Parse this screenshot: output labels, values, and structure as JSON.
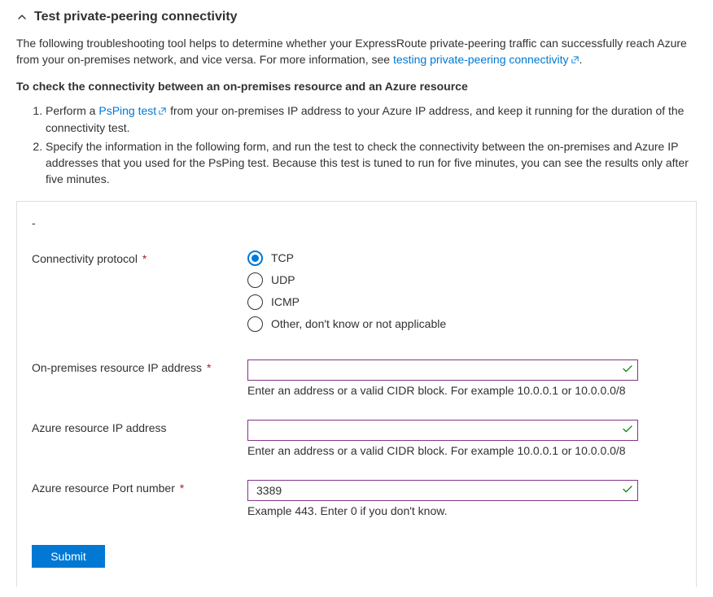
{
  "header": {
    "title": "Test private-peering connectivity"
  },
  "intro": {
    "text_before_link": "The following troubleshooting tool helps to determine whether your ExpressRoute private-peering traffic can successfully reach Azure from your on-premises network, and vice versa. For more information, see ",
    "link_text": "testing private-peering connectivity",
    "text_after_link": "."
  },
  "subheading": "To check the connectivity between an on-premises resource and an Azure resource",
  "steps": {
    "item1_before": "Perform a ",
    "item1_link": "PsPing test",
    "item1_after": " from your on-premises IP address to your Azure IP address, and keep it running for the duration of the connectivity test.",
    "item2": "Specify the information in the following form, and run the test to check the connectivity between the on-premises and Azure IP addresses that you used for the PsPing test. Because this test is tuned to run for five minutes, you can see the results only after five minutes."
  },
  "dash": "-",
  "form": {
    "protocol": {
      "label": "Connectivity protocol",
      "required": "*",
      "options": {
        "tcp": "TCP",
        "udp": "UDP",
        "icmp": "ICMP",
        "other": "Other, don't know or not applicable"
      },
      "selected": "tcp"
    },
    "onprem_ip": {
      "label": "On-premises resource IP address",
      "required": "*",
      "value": "",
      "hint": "Enter an address or a valid CIDR block. For example 10.0.0.1 or 10.0.0.0/8"
    },
    "azure_ip": {
      "label": "Azure resource IP address",
      "value": "",
      "hint": "Enter an address or a valid CIDR block. For example 10.0.0.1 or 10.0.0.0/8"
    },
    "azure_port": {
      "label": "Azure resource Port number",
      "required": "*",
      "value": "3389",
      "hint": "Example 443. Enter 0 if you don't know."
    },
    "submit_label": "Submit"
  }
}
